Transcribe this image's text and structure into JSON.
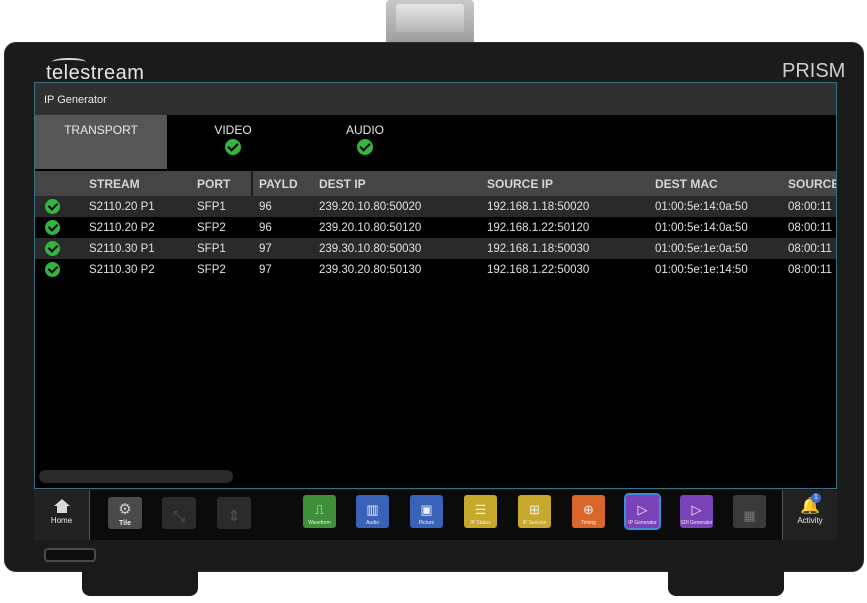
{
  "device": {
    "brand": "telestream",
    "model": "PRISM"
  },
  "app": {
    "title": "IP Generator"
  },
  "tabs": [
    {
      "label": "TRANSPORT",
      "active": true,
      "status": ""
    },
    {
      "label": "VIDEO",
      "active": false,
      "status": "ok"
    },
    {
      "label": "AUDIO",
      "active": false,
      "status": "ok"
    }
  ],
  "table": {
    "columns": [
      "STREAM",
      "PORT",
      "PAYLD",
      "DEST IP",
      "SOURCE IP",
      "DEST MAC",
      "SOURCE"
    ],
    "rows": [
      {
        "status": "ok",
        "stream": "S2110.20 P1",
        "port": "SFP1",
        "payld": "96",
        "dest_ip": "239.20.10.80:50020",
        "source_ip": "192.168.1.18:50020",
        "dest_mac": "01:00:5e:14:0a:50",
        "source": "08:00:11"
      },
      {
        "status": "ok",
        "stream": "S2110.20 P2",
        "port": "SFP2",
        "payld": "96",
        "dest_ip": "239.20.10.80:50120",
        "source_ip": "192.168.1.22:50120",
        "dest_mac": "01:00:5e:14:0a:50",
        "source": "08:00:11"
      },
      {
        "status": "ok",
        "stream": "S2110.30 P1",
        "port": "SFP1",
        "payld": "97",
        "dest_ip": "239.30.10.80:50030",
        "source_ip": "192.168.1.18:50030",
        "dest_mac": "01:00:5e:1e:0a:50",
        "source": "08:00:11"
      },
      {
        "status": "ok",
        "stream": "S2110.30 P2",
        "port": "SFP2",
        "payld": "97",
        "dest_ip": "239.30.20.80:50130",
        "source_ip": "192.168.1.22:50030",
        "dest_mac": "01:00:5e:1e:14:50",
        "source": "08:00:11"
      }
    ]
  },
  "toolbar": {
    "home_label": "Home",
    "tile_label": "Tile",
    "apps": [
      {
        "label": "Waveform",
        "icon": "waveform-icon",
        "color": "#3d8f3a"
      },
      {
        "label": "Audio",
        "icon": "audio-bars-icon",
        "color": "#3a62b8"
      },
      {
        "label": "Picture",
        "icon": "picture-icon",
        "color": "#3a62b8"
      },
      {
        "label": "IP Status",
        "icon": "ip-status-icon",
        "color": "#c6a82a"
      },
      {
        "label": "IP Session",
        "icon": "ip-session-icon",
        "color": "#c6a82a"
      },
      {
        "label": "Timing",
        "icon": "timing-crosshair-icon",
        "color": "#d9662a"
      },
      {
        "label": "IP Generator",
        "icon": "ip-generator-icon",
        "color": "#7a42b8"
      },
      {
        "label": "SDI Generator",
        "icon": "sdi-generator-icon",
        "color": "#7a42b8"
      }
    ],
    "activity_label": "Activity",
    "activity_count": "1"
  }
}
